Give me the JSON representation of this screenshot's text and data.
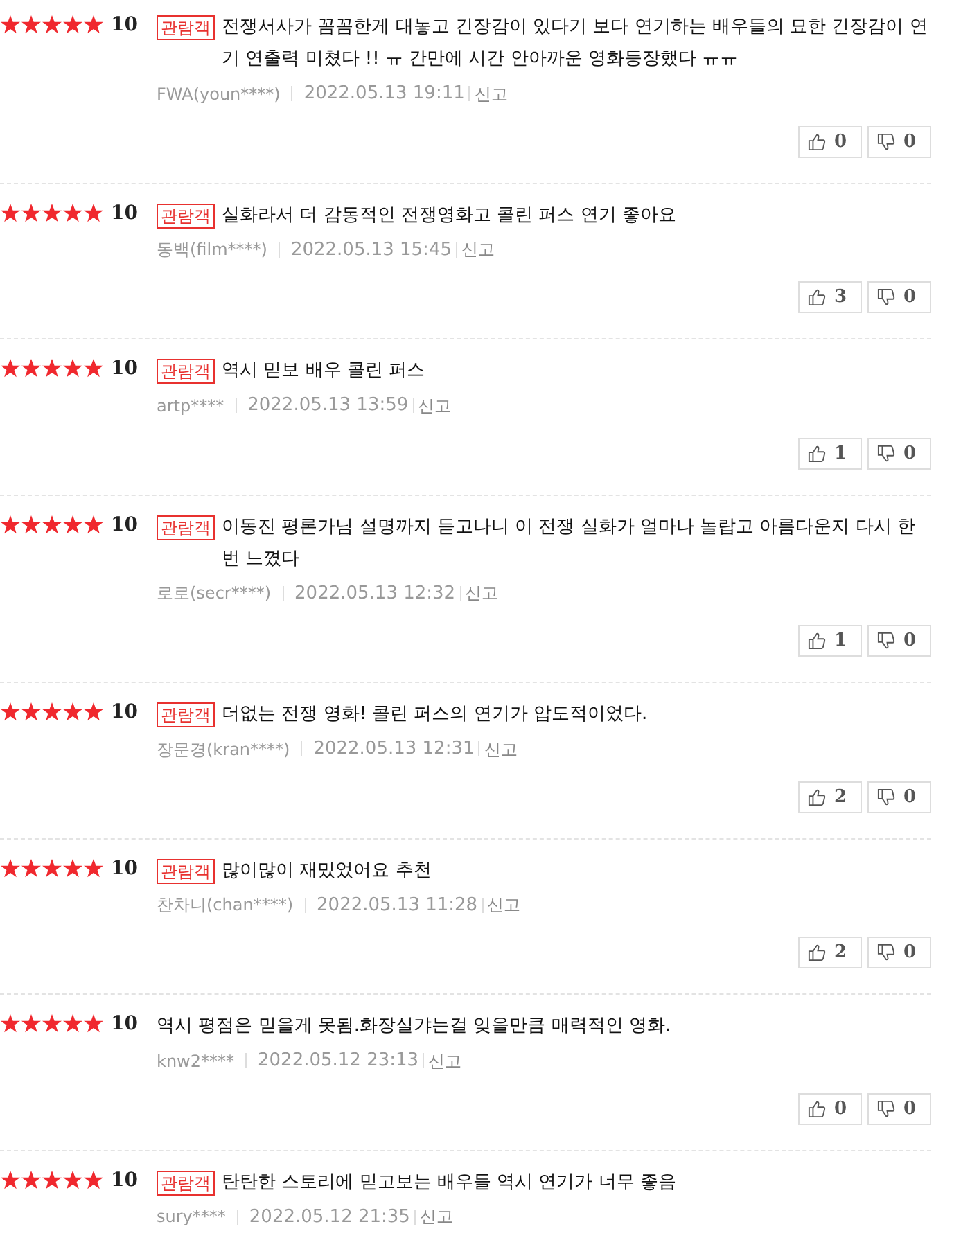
{
  "reviews": [
    {
      "stars": 5,
      "score": "10",
      "badge": "관람객",
      "text": "전쟁서사가 꼼꼼한게 대놓고 긴장감이 있다기 보다 연기하는 배우들의 묘한 긴장감이 연기 연출력 미쳤다 !! ㅠ 간만에 시간 안아까운 영화등장했다 ㅠㅠ",
      "author": "FWA(youn****)",
      "date": "2022.05.13 19:11",
      "report": "신고",
      "likes": "0",
      "dislikes": "0"
    },
    {
      "stars": 5,
      "score": "10",
      "badge": "관람객",
      "text": "실화라서 더 감동적인 전쟁영화고 콜린 퍼스 연기 좋아요",
      "author": "동백(film****)",
      "date": "2022.05.13 15:45",
      "report": "신고",
      "likes": "3",
      "dislikes": "0"
    },
    {
      "stars": 5,
      "score": "10",
      "badge": "관람객",
      "text": "역시 믿보 배우 콜린 퍼스",
      "author": "artp****",
      "date": "2022.05.13 13:59",
      "report": "신고",
      "likes": "1",
      "dislikes": "0"
    },
    {
      "stars": 5,
      "score": "10",
      "badge": "관람객",
      "text": "이동진 평론가님 설명까지 듣고나니 이 전쟁 실화가 얼마나 놀랍고 아름다운지 다시 한 번 느꼈다",
      "author": "로로(secr****)",
      "date": "2022.05.13 12:32",
      "report": "신고",
      "likes": "1",
      "dislikes": "0"
    },
    {
      "stars": 5,
      "score": "10",
      "badge": "관람객",
      "text": "더없는 전쟁 영화! 콜린 퍼스의 연기가 압도적이었다.",
      "author": "장문경(kran****)",
      "date": "2022.05.13 12:31",
      "report": "신고",
      "likes": "2",
      "dislikes": "0"
    },
    {
      "stars": 5,
      "score": "10",
      "badge": "관람객",
      "text": "많이많이 재밌었어요 추천",
      "author": "찬차니(chan****)",
      "date": "2022.05.13 11:28",
      "report": "신고",
      "likes": "2",
      "dislikes": "0"
    },
    {
      "stars": 5,
      "score": "10",
      "text": "역시 평점은 믿을게 못됨.화장실갸는걸 잊을만큼 매력적인 영화.",
      "author": "knw2****",
      "date": "2022.05.12 23:13",
      "report": "신고",
      "likes": "0",
      "dislikes": "0"
    },
    {
      "stars": 5,
      "score": "10",
      "badge": "관람객",
      "text": "탄탄한 스토리에 믿고보는 배우들 역시 연기가 너무 좋음",
      "author": "sury****",
      "date": "2022.05.12 21:35",
      "report": "신고"
    }
  ]
}
